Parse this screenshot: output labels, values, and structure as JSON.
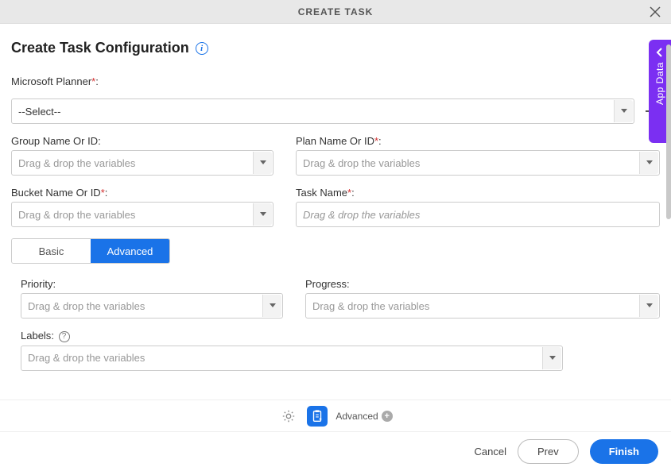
{
  "header": {
    "title": "CREATE TASK"
  },
  "page_title": "Create Task Configuration",
  "side_tab": "App Data",
  "fields": {
    "planner": {
      "label": "Microsoft Planner",
      "value": "--Select--"
    },
    "group": {
      "label": "Group Name Or ID",
      "placeholder": "Drag & drop the variables"
    },
    "plan": {
      "label": "Plan Name Or ID",
      "placeholder": "Drag & drop the variables"
    },
    "bucket": {
      "label": "Bucket Name Or ID",
      "placeholder": "Drag & drop the variables"
    },
    "task": {
      "label": "Task Name",
      "placeholder": "Drag & drop the variables"
    },
    "priority": {
      "label": "Priority",
      "placeholder": "Drag & drop the variables"
    },
    "progress": {
      "label": "Progress",
      "placeholder": "Drag & drop the variables"
    },
    "labels": {
      "label": "Labels",
      "placeholder": "Drag & drop the variables"
    }
  },
  "tabs": {
    "basic": "Basic",
    "advanced": "Advanced",
    "active": "advanced"
  },
  "bottom": {
    "advanced_label": "Advanced"
  },
  "footer": {
    "cancel": "Cancel",
    "prev": "Prev",
    "finish": "Finish"
  }
}
